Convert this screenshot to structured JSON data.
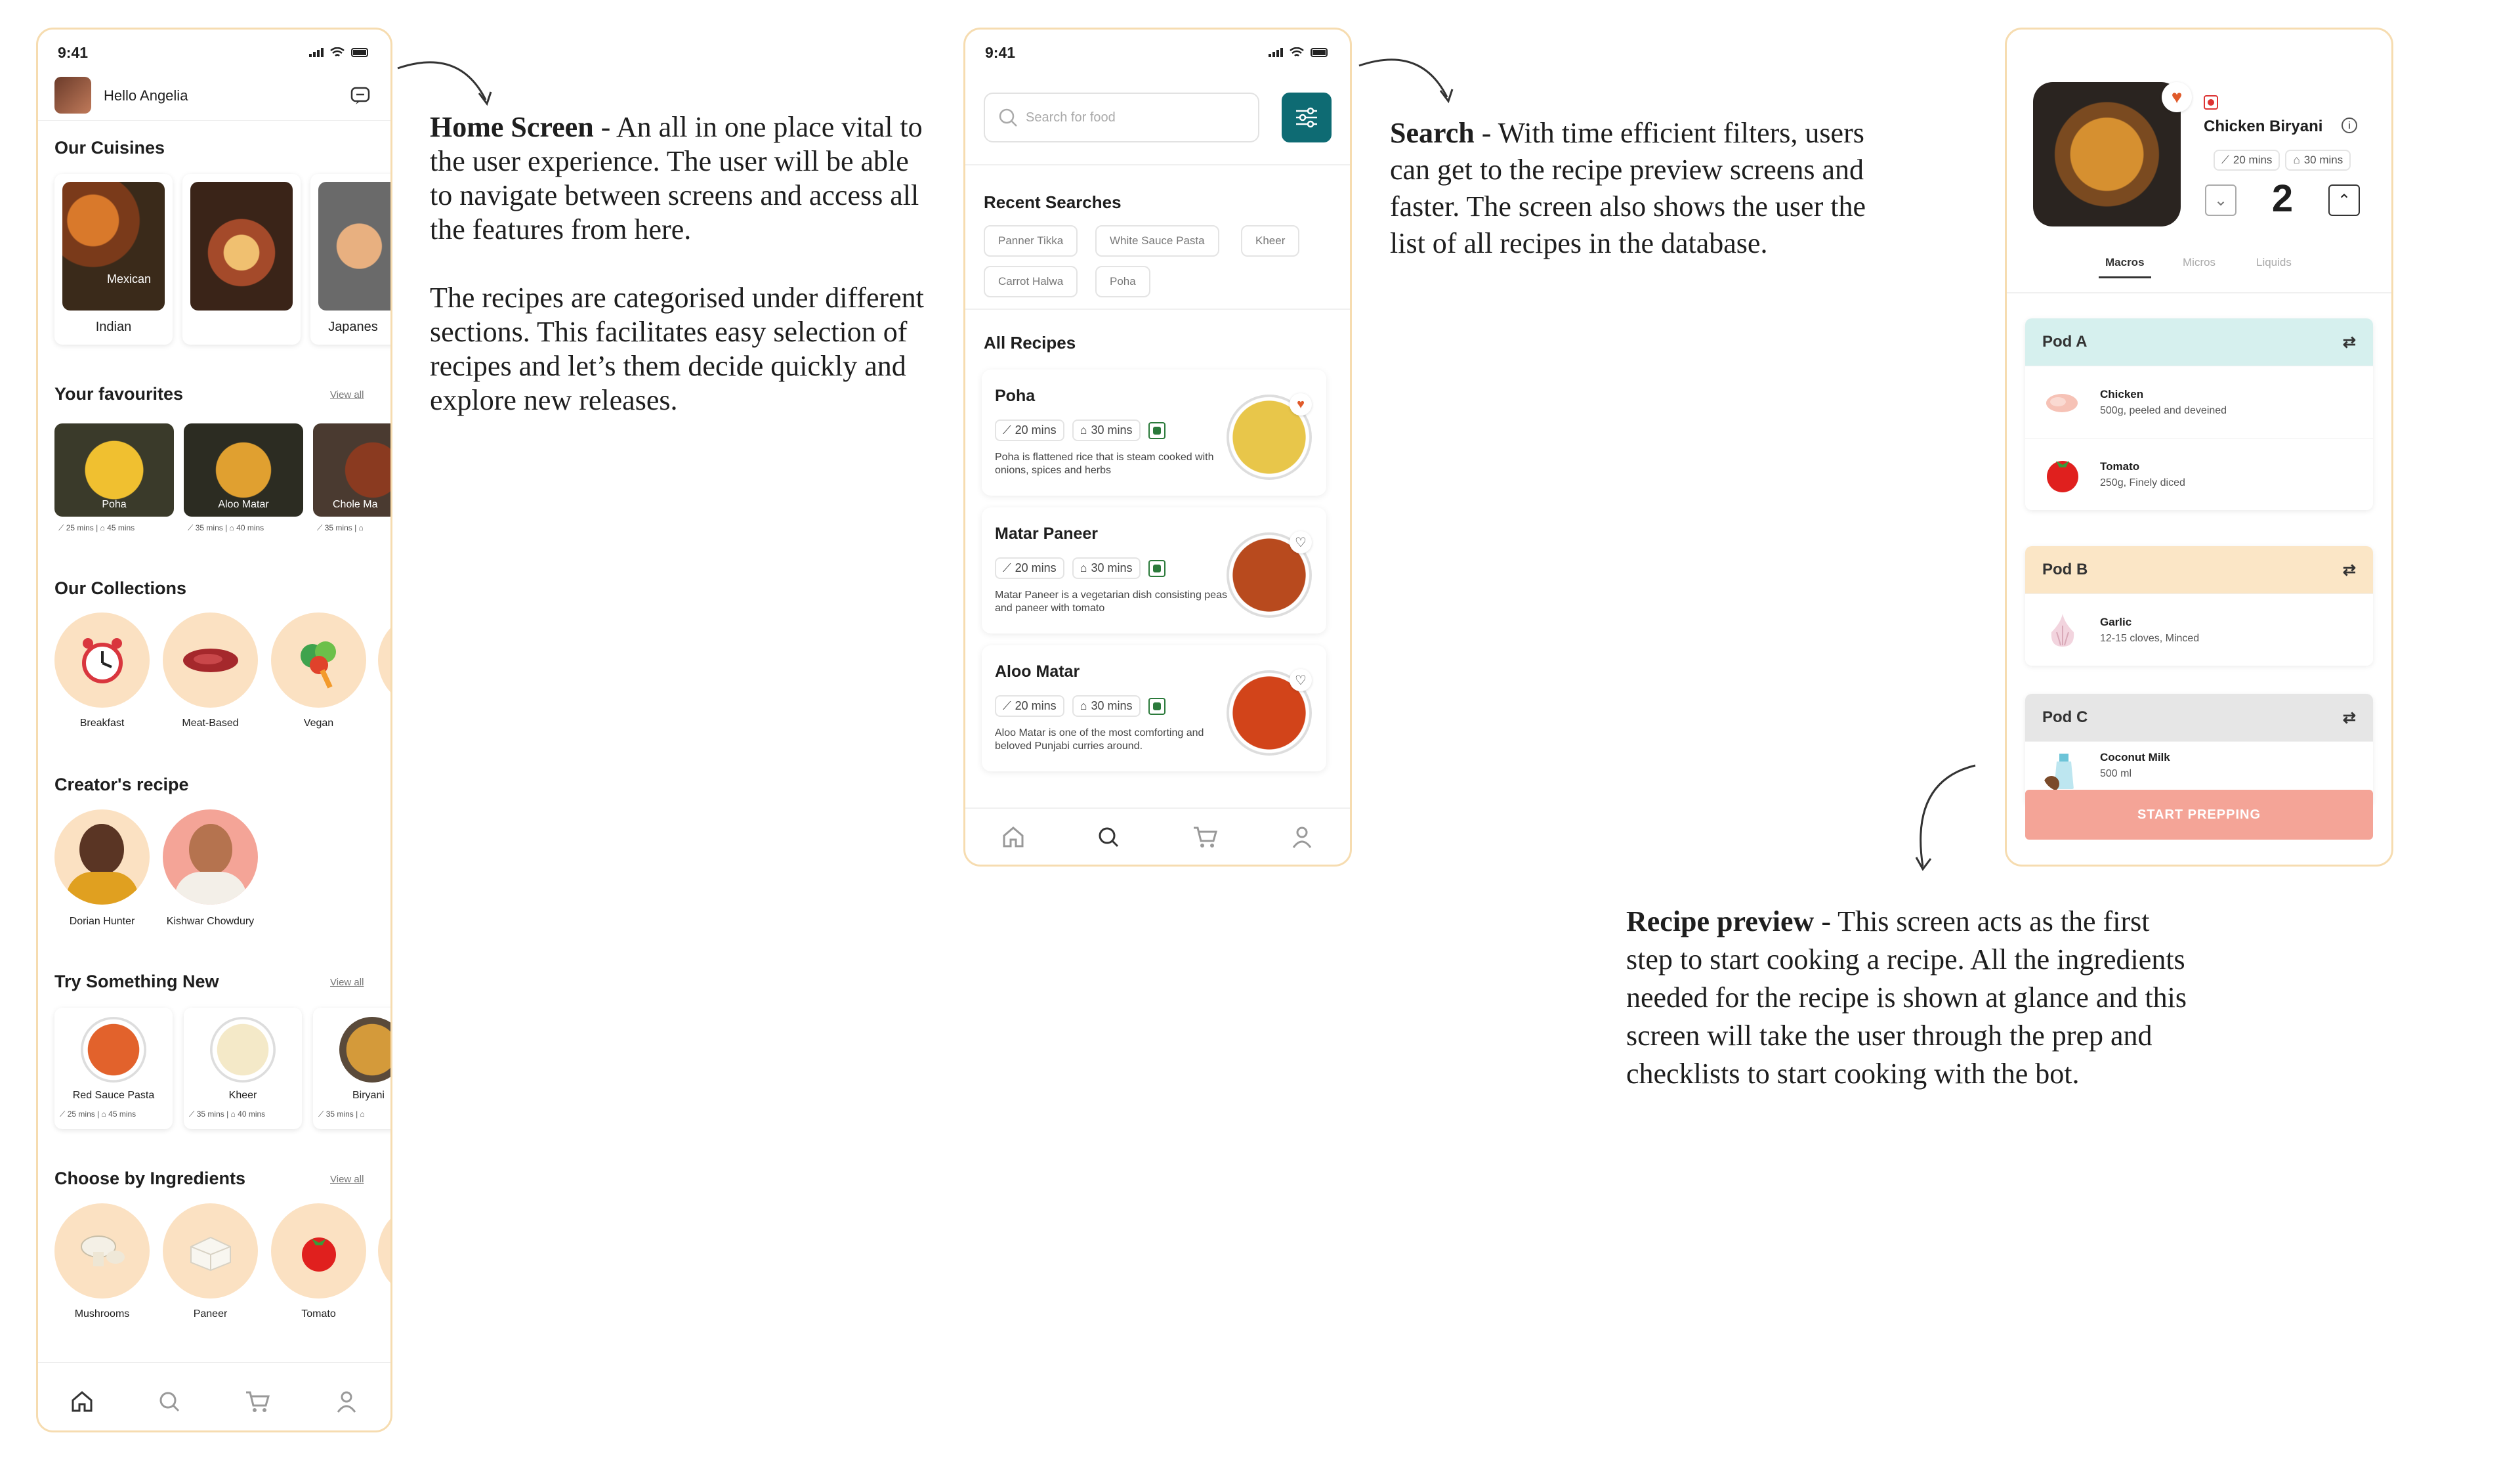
{
  "home": {
    "time": "9:41",
    "greeting": "Hello Angelia",
    "cuisines_title": "Our Cuisines",
    "cuisines": [
      {
        "label": "Indian",
        "overlay": "Mexican"
      },
      {
        "label": ""
      },
      {
        "label": "Japanes"
      }
    ],
    "favourites_title": "Your favourites",
    "view_all": "View all",
    "favourites": [
      {
        "name": "Poha",
        "prep": "25 mins",
        "cook": "45 mins"
      },
      {
        "name": "Aloo Matar",
        "prep": "35 mins",
        "cook": "40 mins"
      },
      {
        "name": "Chole Ma",
        "prep": "35 mins",
        "cook": ""
      }
    ],
    "collections_title": "Our Collections",
    "collections": [
      {
        "label": "Breakfast",
        "icon": "clock-icon"
      },
      {
        "label": "Meat-Based",
        "icon": "meat-icon"
      },
      {
        "label": "Vegan",
        "icon": "vegetable-icon"
      }
    ],
    "creators_title": "Creator's recipe",
    "creators": [
      {
        "name": "Dorian Hunter"
      },
      {
        "name": "Kishwar Chowdury"
      }
    ],
    "try_title": "Try Something New",
    "try": [
      {
        "name": "Red Sauce Pasta",
        "prep": "25 mins",
        "cook": "45 mins"
      },
      {
        "name": "Kheer",
        "prep": "35 mins",
        "cook": "40 mins"
      },
      {
        "name": "Biryani",
        "prep": "35 mins",
        "cook": ""
      }
    ],
    "ingredients_title": "Choose by Ingredients",
    "ingredients": [
      {
        "label": "Mushrooms"
      },
      {
        "label": "Paneer"
      },
      {
        "label": "Tomato"
      }
    ]
  },
  "search": {
    "time": "9:41",
    "placeholder": "Search for food",
    "recent_title": "Recent Searches",
    "recent": [
      "Panner Tikka",
      "White Sauce Pasta",
      "Kheer",
      "Carrot Halwa",
      "Poha"
    ],
    "all_title": "All Recipes",
    "recipes": [
      {
        "name": "Poha",
        "prep": "20 mins",
        "cook": "30 mins",
        "desc": "Poha is flattened rice that is steam cooked with onions, spices and herbs"
      },
      {
        "name": "Matar Paneer",
        "prep": "20 mins",
        "cook": "30 mins",
        "desc": "Matar Paneer is a vegetarian dish consisting peas and paneer with tomato"
      },
      {
        "name": "Aloo Matar",
        "prep": "20 mins",
        "cook": "30 mins",
        "desc": "Aloo Matar is one of the most comforting and beloved Punjabi curries around."
      }
    ]
  },
  "preview": {
    "title": "Chicken Biryani",
    "prep": "20 mins",
    "cook": "30 mins",
    "servings": "2",
    "tabs": [
      "Macros",
      "Micros",
      "Liquids"
    ],
    "pods": [
      {
        "name": "Pod A",
        "color": "#d6f0ee",
        "items": [
          {
            "name": "Chicken",
            "desc": "500g, peeled and deveined"
          },
          {
            "name": "Tomato",
            "desc": "250g, Finely diced"
          }
        ]
      },
      {
        "name": "Pod B",
        "color": "#fbe6c6",
        "items": [
          {
            "name": "Garlic",
            "desc": "12-15 cloves, Minced"
          }
        ]
      },
      {
        "name": "Pod C",
        "color": "#e6e6e6",
        "items": [
          {
            "name": "Coconut Milk",
            "desc": "500 ml"
          }
        ]
      }
    ],
    "cta": "START PREPPING"
  },
  "annotations": {
    "home_title": "Home Screen",
    "home_p1": " - An all in one place vital to the user experience. The user will be able to navigate between screens and access all the features from here.",
    "home_p2": "The recipes are categorised under different sections. This facilitates easy selection of recipes and let’s them decide quickly and explore new releases.",
    "search_title": "Search",
    "search_body": " - With time efficient filters, users can get to the recipe preview screens and faster. The screen also shows the user the list of all recipes in the database.",
    "preview_title": "Recipe preview",
    "preview_body": " - This screen acts as the first step to start cooking a recipe. All the ingredients needed for the recipe is shown at glance and this screen will take the user through the prep and checklists to start cooking with the bot."
  },
  "colors": {
    "accent": "#0e6b73",
    "phone_border": "#f6dcb0",
    "cta": "#f4a497",
    "heart": "#e05a2a"
  }
}
